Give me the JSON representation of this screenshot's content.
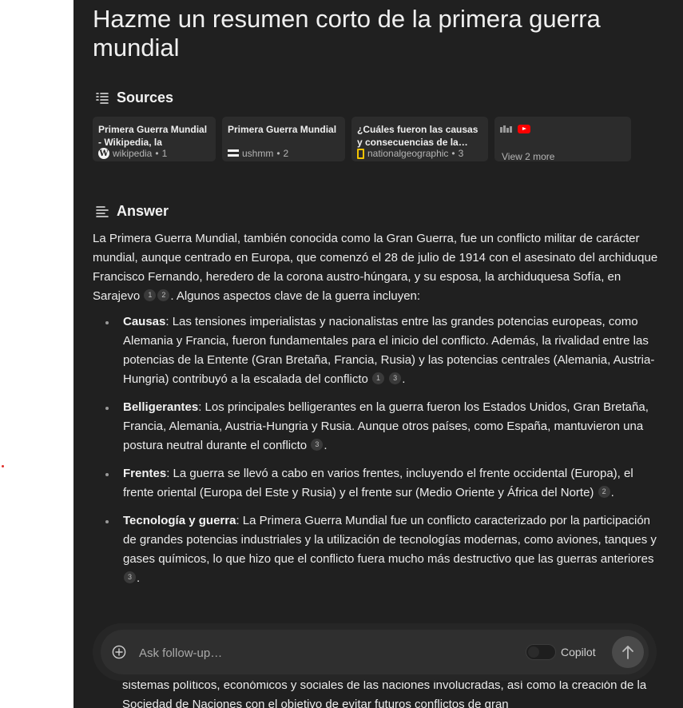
{
  "question": "Hazme un resumen corto de la primera guerra mundial",
  "sources": {
    "heading": "Sources",
    "cards": [
      {
        "title": "Primera Guerra Mundial - Wikipedia, la enciclopedi…",
        "site": "wikipedia",
        "index": "1",
        "icon": "wikipedia-icon"
      },
      {
        "title": "Primera Guerra Mundial",
        "site": "ushmm",
        "index": "2",
        "icon": "ushmm-icon"
      },
      {
        "title": "¿Cuáles fueron las causas y consecuencias de la…",
        "site": "nationalgeographic",
        "index": "3",
        "icon": "natgeo-icon"
      }
    ],
    "more_label": "View 2 more"
  },
  "answer": {
    "heading": "Answer",
    "intro": "La Primera Guerra Mundial, también conocida como la Gran Guerra, fue un conflicto militar de carácter mundial, aunque centrado en Europa, que comenzó el 28 de julio de 1914 con el asesinato del archiduque Francisco Fernando, heredero de la corona austro-húngara, y su esposa, la archiduquesa Sofía, en Sarajevo",
    "intro_cites": [
      "1",
      "2"
    ],
    "intro_tail": ". Algunos aspectos clave de la guerra incluyen:",
    "points": [
      {
        "label": "Causas",
        "text": ": Las tensiones imperialistas y nacionalistas entre las grandes potencias europeas, como Alemania y Francia, fueron fundamentales para el inicio del conflicto. Además, la rivalidad entre las potencias de la Entente (Gran Bretaña, Francia, Rusia) y las potencias centrales (Alemania, Austria-Hungria) contribuyó a la escalada del conflicto",
        "cites": [
          "1",
          "3"
        ]
      },
      {
        "label": "Belligerantes",
        "text": ": Los principales belligerantes en la guerra fueron los Estados Unidos, Gran Bretaña, Francia, Alemania, Austria-Hungria y Rusia. Aunque otros países, como España, mantuvieron una postura neutral durante el conflicto",
        "cites": [
          "3"
        ]
      },
      {
        "label": "Frentes",
        "text": ": La guerra se llevó a cabo en varios frentes, incluyendo el frente occidental (Europa), el frente oriental (Europa del Este y Rusia) y el frente sur (Medio Oriente y África del Norte)",
        "cites": [
          "2"
        ]
      },
      {
        "label": "Tecnología y guerra",
        "text": ": La Primera Guerra Mundial fue un conflicto caracterizado por la participación de grandes potencias industriales y la utilización de tecnologías modernas, como aviones, tanques y gases químicos, lo que hizo que el conflicto fuera mucho más destructivo que las guerras anteriores",
        "cites": [
          "3"
        ]
      }
    ],
    "overflow_text": "sistemas políticos, económicos y sociales de las naciones involucradas, así como la creación de la Sociedad de Naciones con el objetivo de evitar futuros conflictos de gran"
  },
  "composer": {
    "placeholder": "Ask follow-up…",
    "copilot_label": "Copilot",
    "copilot_enabled": false
  },
  "colors": {
    "background": "#202020",
    "card": "#2c2c2c",
    "accent_marker": "#e0302a"
  }
}
